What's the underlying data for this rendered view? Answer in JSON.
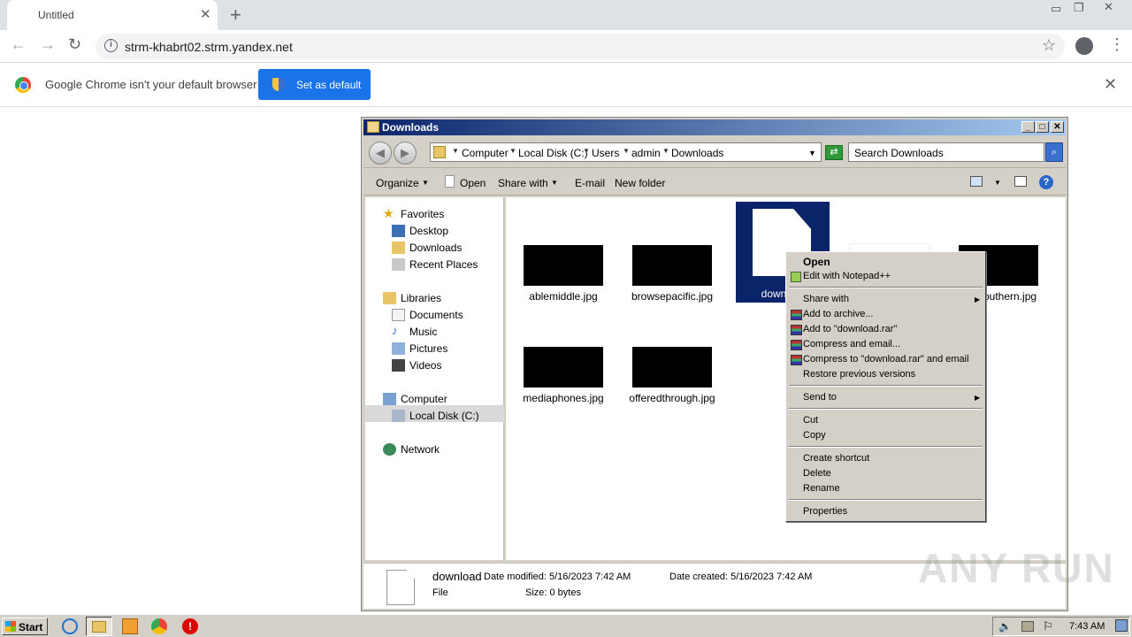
{
  "browser": {
    "tab_title": "Untitled",
    "url": "strm-khabrt02.strm.yandex.net",
    "infobar_text": "Google Chrome isn't your default browser",
    "set_default_label": "Set as default"
  },
  "explorer": {
    "title": "Downloads",
    "breadcrumbs": [
      "Computer",
      "Local Disk (C:)",
      "Users",
      "admin",
      "Downloads"
    ],
    "search_placeholder": "Search Downloads",
    "commands": {
      "organize": "Organize",
      "open": "Open",
      "share_with": "Share with",
      "email": "E-mail",
      "new_folder": "New folder"
    },
    "nav": {
      "favorites": "Favorites",
      "desktop": "Desktop",
      "downloads": "Downloads",
      "recent_places": "Recent Places",
      "libraries": "Libraries",
      "documents": "Documents",
      "music": "Music",
      "pictures": "Pictures",
      "videos": "Videos",
      "computer": "Computer",
      "local_disk": "Local Disk (C:)",
      "network": "Network"
    },
    "files": {
      "f1": "ablemiddle.jpg",
      "f2": "browsepacific.jpg",
      "f3": "downl",
      "f4": "outhern.jpg",
      "f5": "mediaphones.jpg",
      "f6": "offeredthrough.jpg"
    },
    "details": {
      "name": "download",
      "type": "File",
      "modified": "Date modified: 5/16/2023 7:42 AM",
      "created": "Date created: 5/16/2023 7:42 AM",
      "size": "Size: 0 bytes"
    }
  },
  "context_menu": {
    "open": "Open",
    "edit_notepad": "Edit with Notepad++",
    "share_with": "Share with",
    "add_archive": "Add to archive...",
    "add_rar": "Add to \"download.rar\"",
    "compress_email": "Compress and email...",
    "compress_rar_email": "Compress to \"download.rar\" and email",
    "restore": "Restore previous versions",
    "send_to": "Send to",
    "cut": "Cut",
    "copy": "Copy",
    "create_shortcut": "Create shortcut",
    "delete": "Delete",
    "rename": "Rename",
    "properties": "Properties"
  },
  "taskbar": {
    "start": "Start",
    "clock": "7:43 AM"
  },
  "watermark": "ANY RUN",
  "icons": [
    "info-icon",
    "star-icon",
    "profile-icon",
    "menu-icon",
    "chrome-logo-icon",
    "shield-icon",
    "folder-icon",
    "search-icon",
    "help-icon"
  ]
}
